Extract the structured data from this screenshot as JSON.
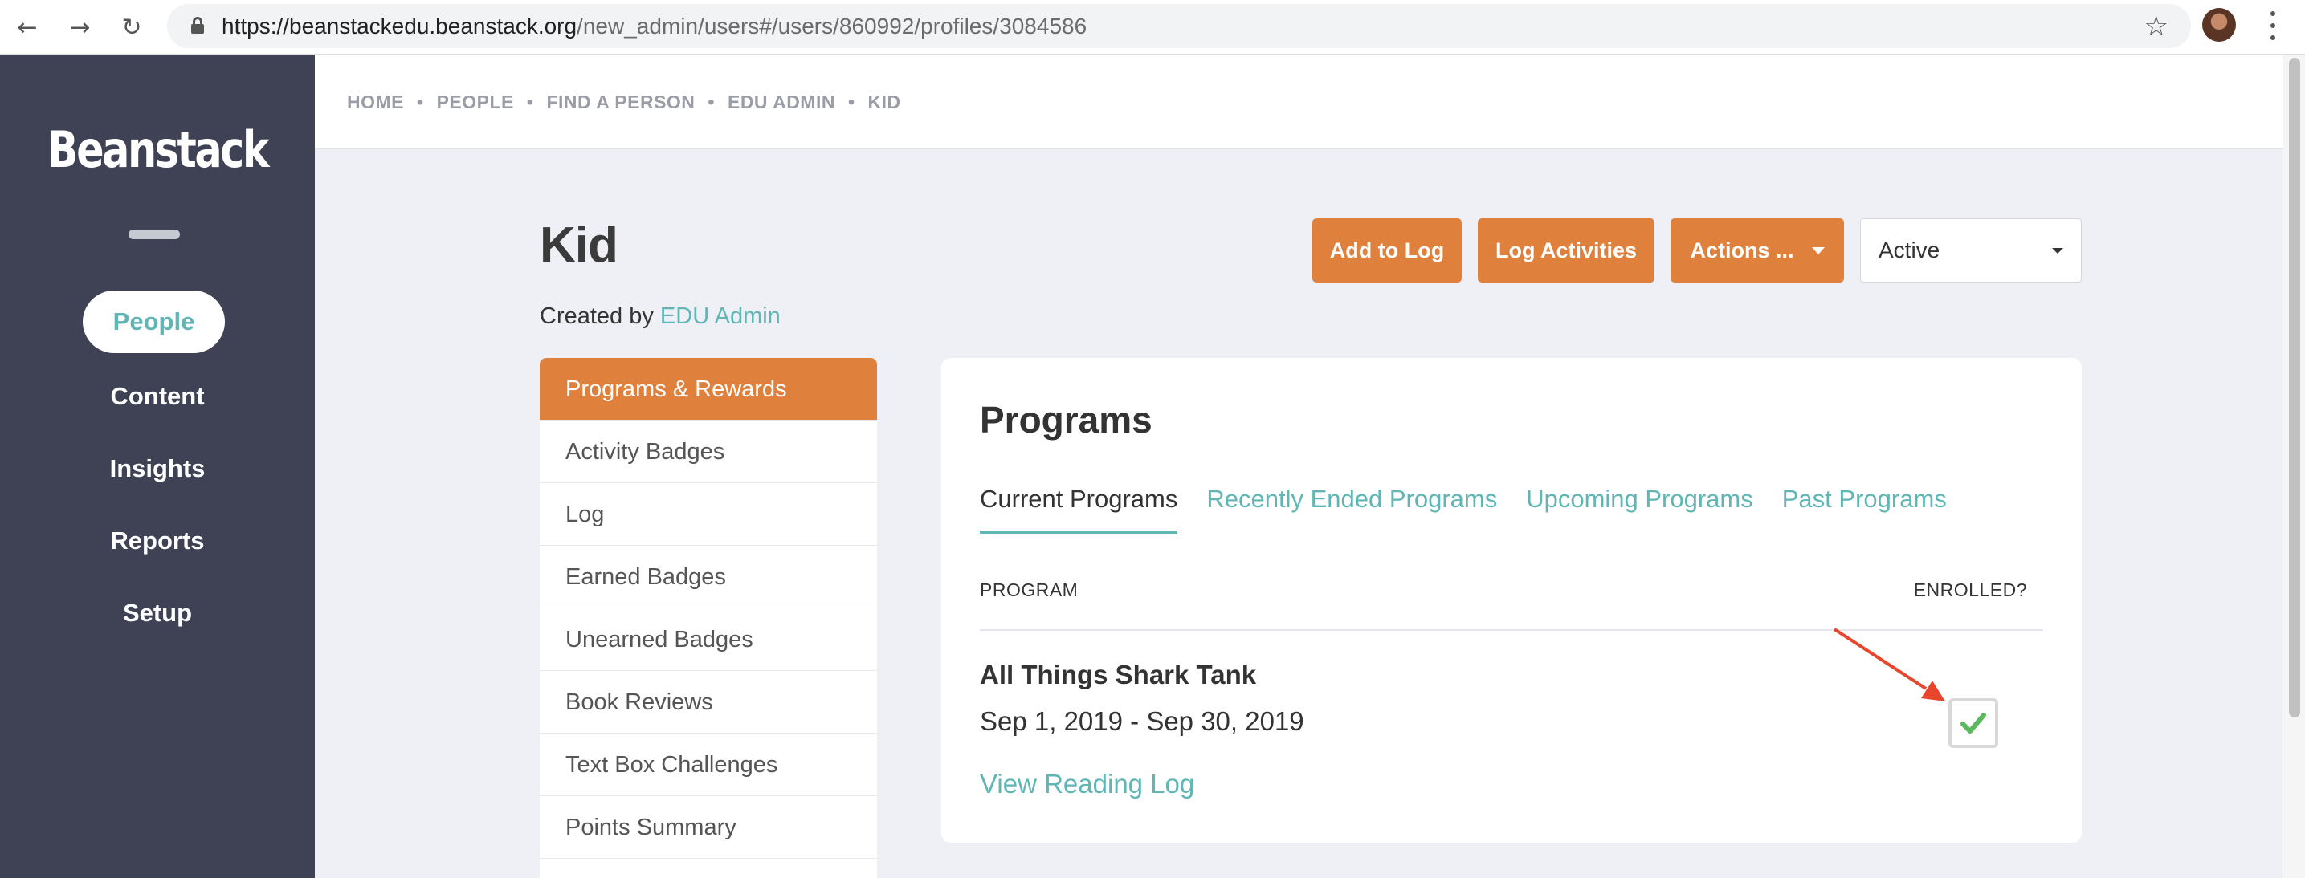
{
  "browser": {
    "url_host": "https://beanstackedu.beanstack.org",
    "url_path": "/new_admin/users#/users/860992/profiles/3084586"
  },
  "sidebar": {
    "logo": "Beanstack",
    "items": [
      {
        "label": "People",
        "active": true
      },
      {
        "label": "Content"
      },
      {
        "label": "Insights"
      },
      {
        "label": "Reports"
      },
      {
        "label": "Setup"
      }
    ]
  },
  "breadcrumb": [
    "HOME",
    "PEOPLE",
    "FIND A PERSON",
    "EDU ADMIN",
    "KID"
  ],
  "header": {
    "title": "Kid",
    "created_by_prefix": "Created by",
    "created_by_name": "EDU Admin",
    "buttons": {
      "add_to_log": "Add to Log",
      "log_activities": "Log Activities",
      "actions": "Actions ..."
    },
    "status": "Active"
  },
  "submenu": [
    "Programs & Rewards",
    "Activity Badges",
    "Log",
    "Earned Badges",
    "Unearned Badges",
    "Book Reviews",
    "Text Box Challenges",
    "Points Summary"
  ],
  "programs": {
    "title": "Programs",
    "tabs": [
      "Current Programs",
      "Recently Ended Programs",
      "Upcoming Programs",
      "Past Programs"
    ],
    "columns": {
      "program": "PROGRAM",
      "enrolled": "ENROLLED?"
    },
    "rows": [
      {
        "name": "All Things Shark Tank",
        "dates": "Sep 1, 2019 - Sep 30, 2019",
        "link": "View Reading Log",
        "enrolled": true
      }
    ]
  },
  "colors": {
    "sidebar_bg": "#3e4254",
    "accent_orange": "#e0803d",
    "accent_teal": "#5fb6b4",
    "check_green": "#5cb85c",
    "annotation_red": "#e8452c"
  }
}
